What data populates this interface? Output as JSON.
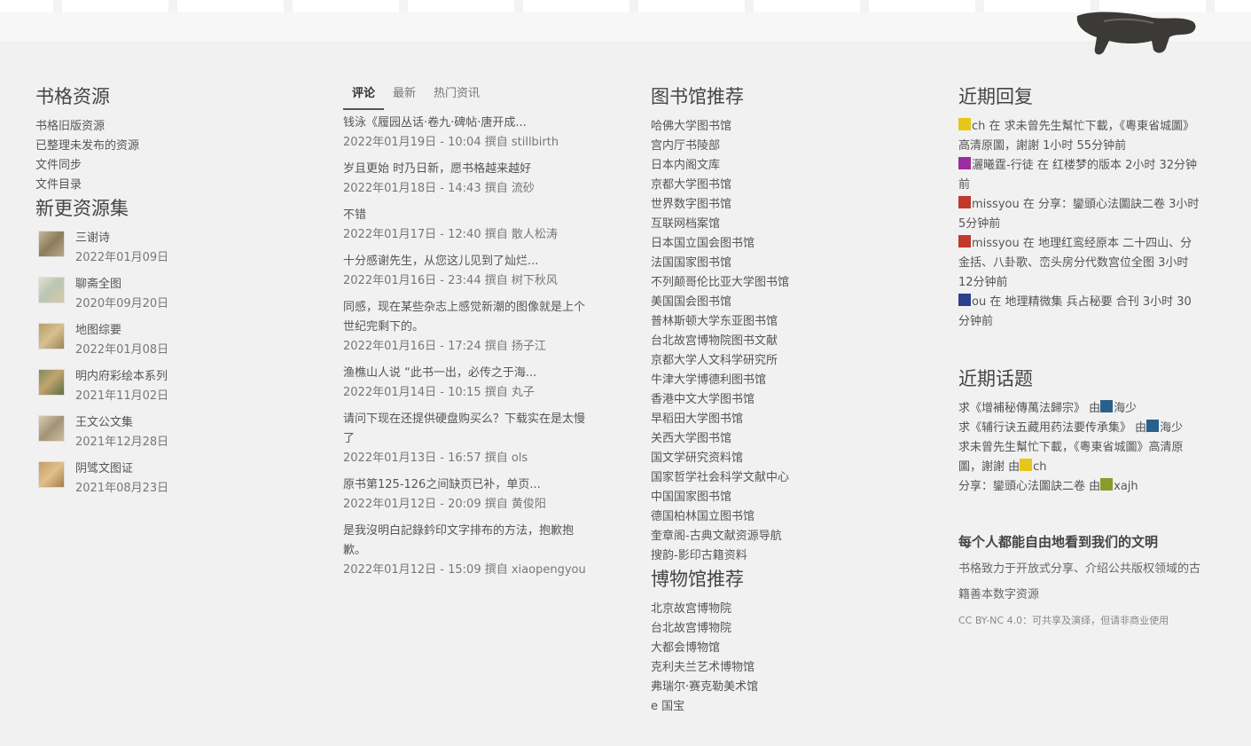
{
  "header": {
    "logo_icon": "bull-bronze-icon"
  },
  "shuge": {
    "title": "书格资源",
    "links": [
      "书格旧版资源",
      "已整理未发布的资源",
      "文件同步",
      "文件目录"
    ]
  },
  "newsets": {
    "title": "新更资源集",
    "items": [
      {
        "name": "三谢诗",
        "date": "2022年01月09日"
      },
      {
        "name": "聊斋全图",
        "date": "2020年09月20日"
      },
      {
        "name": "地图综要",
        "date": "2022年01月08日"
      },
      {
        "name": "明内府彩绘本系列",
        "date": "2021年11月02日"
      },
      {
        "name": "王文公文集",
        "date": "2021年12月28日"
      },
      {
        "name": "阴骘文图证",
        "date": "2021年08月23日"
      }
    ]
  },
  "tabs": [
    "评论",
    "最新",
    "热门资讯"
  ],
  "comments": [
    {
      "text": "钱泳《履园丛话·卷九·碑帖·唐开成...",
      "meta": "2022年01月19日 - 10:04 撰自 stillbirth"
    },
    {
      "text": "岁且更始 时乃日新，愿书格越来越好",
      "meta": "2022年01月18日 - 14:43 撰自 流砂"
    },
    {
      "text": "不错",
      "meta": "2022年01月17日 - 12:40 撰自 散人松涛"
    },
    {
      "text": "十分感谢先生，从您这儿见到了灿烂...",
      "meta": "2022年01月16日 - 23:44 撰自 树下秋风"
    },
    {
      "text": "同感，现在某些杂志上感觉新潮的图像就是上个世纪完剩下的。",
      "meta": "2022年01月16日 - 17:24 撰自 扬子江"
    },
    {
      "text": "渔樵山人说 “此书一出，必传之于海...",
      "meta": "2022年01月14日 - 10:15 撰自 丸子"
    },
    {
      "text": "请问下现在还提供硬盘购买么？下载实在是太慢了",
      "meta": "2022年01月13日 - 16:57 撰自 ols"
    },
    {
      "text": "原书第125-126之间缺页已补，单页...",
      "meta": "2022年01月12日 - 20:09 撰自 黄俊阳"
    },
    {
      "text": "是我沒明白記錄鈐印文字排布的方法，抱歉抱歉。",
      "meta": "2022年01月12日 - 15:09 撰自 xiaopengyou"
    }
  ],
  "libraries": {
    "title": "图书馆推荐",
    "links": [
      "哈佛大学图书馆",
      "宫内厅书陵部",
      "日本内阁文库",
      "京都大学图书馆",
      "世界数字图书馆",
      "互联网档案馆",
      "日本国立国会图书馆",
      "法国国家图书馆",
      "不列颠哥伦比亚大学图书馆",
      "美国国会图书馆",
      "普林斯顿大学东亚图书馆",
      "台北故宫博物院图书文献",
      "京都大学人文科学研究所",
      "牛津大学博德利图书馆",
      "香港中文大学图书馆",
      "早稻田大学图书馆",
      "关西大学图书馆",
      "国文学研究资料馆",
      "国家哲学社会科学文献中心",
      "中国国家图书馆",
      "德国柏林国立图书馆",
      "奎章阁-古典文献资源导航",
      "搜韵-影印古籍资料"
    ]
  },
  "museums": {
    "title": "博物馆推荐",
    "links": [
      "北京故宫博物院",
      "台北故宫博物院",
      "大都会博物馆",
      "克利夫兰艺术博物馆",
      "弗瑞尔·赛克勒美术馆",
      "e 国宝"
    ]
  },
  "replies": {
    "title": "近期回复",
    "items": [
      {
        "avatar": "#e6c619",
        "user": "ch",
        "text": " 在 求未曾先生幫忙下載，《粵東省城圖》高清原圖，謝謝 1小时 55分钟前"
      },
      {
        "avatar": "#9b2d9e",
        "user": "灑曦霆-行徒",
        "text": " 在 红楼梦的版本 2小时 32分钟前"
      },
      {
        "avatar": "#c0392b",
        "user": "missyou",
        "text": " 在 分享：鑾頭心法圖訣二卷 3小时 5分钟前"
      },
      {
        "avatar": "#c0392b",
        "user": "missyou",
        "text": " 在 地理红鸾经原本 二十四山、分金括、八卦歌、峦头房分代数宫位全图 3小时 12分钟前"
      },
      {
        "avatar": "#2b3f8c",
        "user": "ou",
        "text": " 在 地理精微集 兵占秘要 合刊 3小时 30分钟前"
      }
    ]
  },
  "topics": {
    "title": "近期话题",
    "items": [
      {
        "text": "求《增補秘傳萬法歸宗》 由",
        "avatar": "#2b5f8c",
        "user": "海少"
      },
      {
        "text": "求《辅行诀五藏用药法要传承集》 由",
        "avatar": "#2b5f8c",
        "user": "海少"
      },
      {
        "text": "求未曾先生幫忙下載，《粵東省城圖》高清原圖，謝謝 由",
        "avatar": "#e6c619",
        "user": "ch"
      },
      {
        "text": "分享：鑾頭心法圖訣二卷 由",
        "avatar": "#8a9a2b",
        "user": "xajh"
      }
    ]
  },
  "motto": {
    "title": "每个人都能自由地看到我们的文明",
    "body": "书格致力于开放式分享、介绍公共版权领域的古籍善本数字资源",
    "license": "CC BY-NC 4.0：可共享及演绎，但请非商业使用"
  }
}
